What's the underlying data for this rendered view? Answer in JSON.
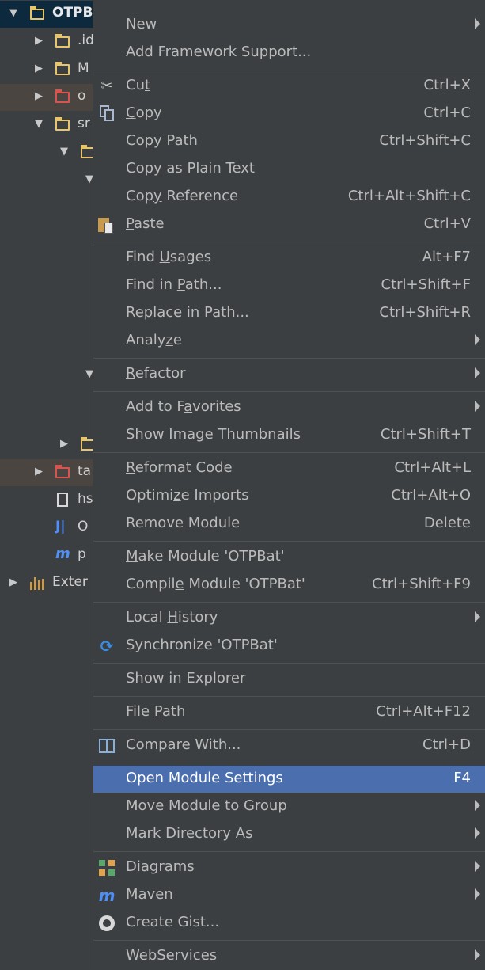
{
  "tree": {
    "items": [
      {
        "label": "OTPB",
        "indent": 0,
        "icon": "module-folder-icon",
        "arrow": "down",
        "style": "bold",
        "row": "highlight-top"
      },
      {
        "label": ".id",
        "indent": 1,
        "icon": "folder-icon",
        "arrow": "right"
      },
      {
        "label": "M",
        "indent": 1,
        "icon": "folder-icon",
        "arrow": "right"
      },
      {
        "label": "o",
        "indent": 1,
        "icon": "excluded-folder-icon",
        "arrow": "right",
        "row": "excluded"
      },
      {
        "label": "sr",
        "indent": 1,
        "icon": "folder-icon",
        "arrow": "down"
      },
      {
        "label": "",
        "indent": 2,
        "icon": "folder-icon",
        "arrow": "down"
      },
      {
        "label": "",
        "indent": 3,
        "icon": "",
        "arrow": "down"
      }
    ],
    "lower_items": [
      {
        "label": "",
        "arrow": "down",
        "indent": 3
      },
      {
        "label": "",
        "arrow": "right",
        "indent": 2,
        "icon": "folder-icon"
      },
      {
        "label": "ta",
        "arrow": "right",
        "indent": 1,
        "icon": "excluded-folder-icon",
        "row": "excluded"
      },
      {
        "label": "hs",
        "indent": 1,
        "icon": "file-icon"
      },
      {
        "label": "O",
        "indent": 1,
        "icon": "iml-file-icon"
      },
      {
        "label": "p",
        "indent": 1,
        "icon": "maven-pom-icon"
      },
      {
        "label": "Exter",
        "indent": 0,
        "icon": "external-libraries-icon",
        "arrow": "right"
      }
    ]
  },
  "menu": {
    "items": [
      {
        "id": "new",
        "label": "New",
        "submenu": true
      },
      {
        "id": "add-framework-support",
        "label": "Add Framework Support..."
      },
      {
        "sep": true
      },
      {
        "id": "cut",
        "label": "Cut",
        "mnemonic": "t",
        "shortcut": "Ctrl+X",
        "icon": "scissors-icon"
      },
      {
        "id": "copy",
        "label": "Copy",
        "mnemonic": "C",
        "shortcut": "Ctrl+C",
        "icon": "copy-icon"
      },
      {
        "id": "copy-path",
        "label": "Copy Path",
        "mnemonic": "p",
        "shortcut": "Ctrl+Shift+C"
      },
      {
        "id": "copy-plain-text",
        "label": "Copy as Plain Text"
      },
      {
        "id": "copy-reference",
        "label": "Copy Reference",
        "mnemonic": "y",
        "shortcut": "Ctrl+Alt+Shift+C"
      },
      {
        "id": "paste",
        "label": "Paste",
        "mnemonic": "P",
        "shortcut": "Ctrl+V",
        "icon": "paste-icon"
      },
      {
        "sep": true
      },
      {
        "id": "find-usages",
        "label": "Find Usages",
        "mnemonic": "U",
        "shortcut": "Alt+F7"
      },
      {
        "id": "find-in-path",
        "label": "Find in Path...",
        "mnemonic": "P",
        "shortcut": "Ctrl+Shift+F"
      },
      {
        "id": "replace-in-path",
        "label": "Replace in Path...",
        "mnemonic": "a",
        "shortcut": "Ctrl+Shift+R"
      },
      {
        "id": "analyze",
        "label": "Analyze",
        "mnemonic": "z",
        "submenu": true
      },
      {
        "sep": true
      },
      {
        "id": "refactor",
        "label": "Refactor",
        "mnemonic": "R",
        "submenu": true
      },
      {
        "sep": true
      },
      {
        "id": "add-to-favorites",
        "label": "Add to Favorites",
        "mnemonic": "a",
        "submenu": true
      },
      {
        "id": "show-image-thumbnails",
        "label": "Show Image Thumbnails",
        "shortcut": "Ctrl+Shift+T"
      },
      {
        "sep": true
      },
      {
        "id": "reformat-code",
        "label": "Reformat Code",
        "mnemonic": "R",
        "shortcut": "Ctrl+Alt+L"
      },
      {
        "id": "optimize-imports",
        "label": "Optimize Imports",
        "mnemonic": "z",
        "shortcut": "Ctrl+Alt+O"
      },
      {
        "id": "remove-module",
        "label": "Remove Module",
        "shortcut": "Delete"
      },
      {
        "sep": true
      },
      {
        "id": "make-module",
        "label": "Make Module 'OTPBat'",
        "mnemonic": "M"
      },
      {
        "id": "compile-module",
        "label": "Compile Module 'OTPBat'",
        "mnemonic": "e",
        "shortcut": "Ctrl+Shift+F9"
      },
      {
        "sep": true
      },
      {
        "id": "local-history",
        "label": "Local History",
        "mnemonic": "H",
        "submenu": true
      },
      {
        "id": "synchronize",
        "label": "Synchronize 'OTPBat'",
        "icon": "sync-icon"
      },
      {
        "sep": true
      },
      {
        "id": "show-in-explorer",
        "label": "Show in Explorer"
      },
      {
        "sep": true
      },
      {
        "id": "file-path",
        "label": "File Path",
        "mnemonic": "P",
        "shortcut": "Ctrl+Alt+F12"
      },
      {
        "sep": true
      },
      {
        "id": "compare-with",
        "label": "Compare With...",
        "shortcut": "Ctrl+D",
        "icon": "compare-icon"
      },
      {
        "sep": true
      },
      {
        "id": "open-module-settings",
        "label": "Open Module Settings",
        "shortcut": "F4",
        "selected": true
      },
      {
        "id": "move-module-to-group",
        "label": "Move Module to Group",
        "submenu": true
      },
      {
        "id": "mark-directory-as",
        "label": "Mark Directory As",
        "submenu": true
      },
      {
        "sep": true
      },
      {
        "id": "diagrams",
        "label": "Diagrams",
        "submenu": true,
        "icon": "diagram-icon"
      },
      {
        "id": "maven",
        "label": "Maven",
        "submenu": true,
        "icon": "maven-icon"
      },
      {
        "id": "create-gist",
        "label": "Create Gist...",
        "icon": "github-icon"
      },
      {
        "sep": true
      },
      {
        "id": "webservices",
        "label": "WebServices",
        "submenu": true
      }
    ]
  }
}
